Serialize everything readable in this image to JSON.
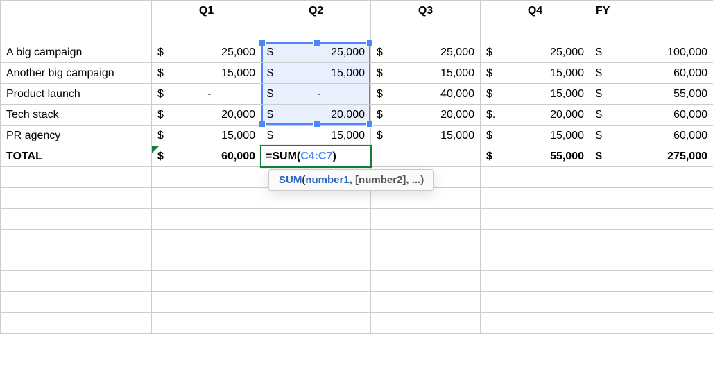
{
  "headers": {
    "q1": "Q1",
    "q2": "Q2",
    "q3": "Q3",
    "q4": "Q4",
    "fy": "FY"
  },
  "currency": "$",
  "dash": "-",
  "rows": {
    "r0": {
      "label": "A big campaign",
      "q1": "25,000",
      "q2": "25,000",
      "q3": "25,000",
      "q4": "25,000",
      "fy": "100,000"
    },
    "r1": {
      "label": "Another big campaign",
      "q1": "15,000",
      "q2": "15,000",
      "q3": "15,000",
      "q4": "15,000",
      "fy": "60,000"
    },
    "r2": {
      "label": "Product launch",
      "q1": "-",
      "q2": "-",
      "q3": "40,000",
      "q4": "15,000",
      "fy": "55,000"
    },
    "r3": {
      "label": "Tech stack",
      "q1": "20,000",
      "q2": "20,000",
      "q3": "20,000",
      "q4_sym": "$.",
      "q4": "20,000",
      "fy": "60,000"
    },
    "r4": {
      "label": "PR agency",
      "q1": "15,000",
      "q2": "15,000",
      "q3": "15,000",
      "q4": "15,000",
      "fy": "60,000"
    }
  },
  "total": {
    "label": "TOTAL",
    "q1": "60,000",
    "q4": "55,000",
    "fy": "275,000"
  },
  "formula": {
    "raw": "=SUM(C4:C7)",
    "eq": "=",
    "fn": "SUM",
    "open": "(",
    "ref": "C4:C7",
    "close": ")"
  },
  "tooltip": {
    "fn": "SUM",
    "open": "(",
    "arg1": "number1",
    "rest": ", [number2], ...)"
  }
}
